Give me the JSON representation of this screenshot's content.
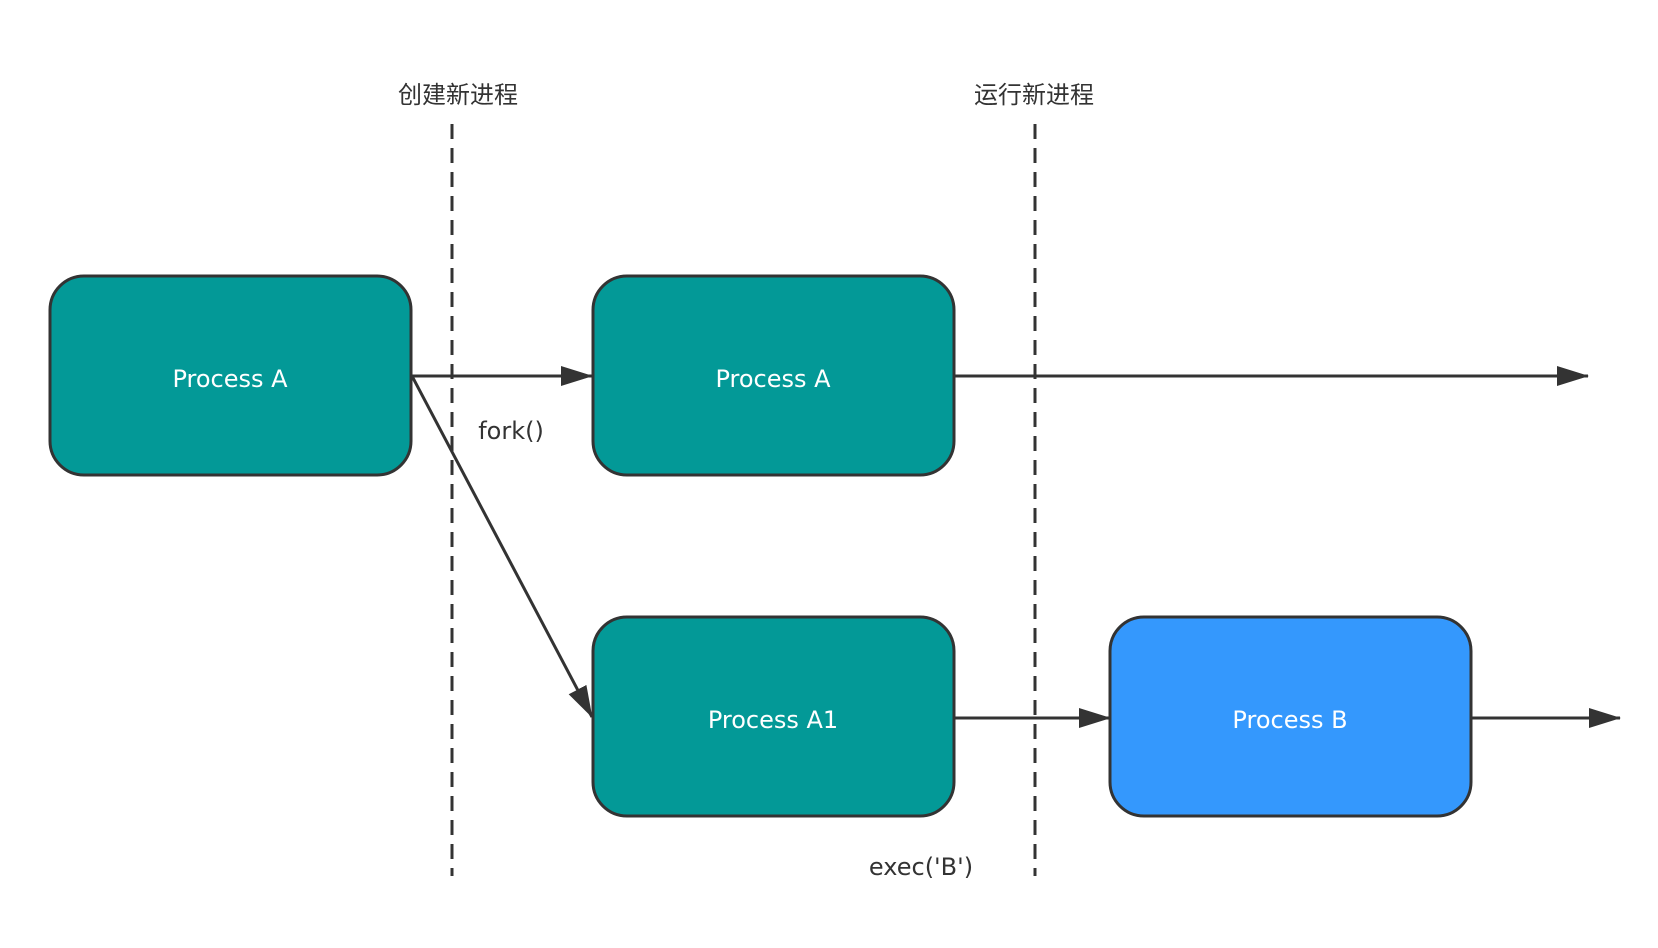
{
  "phase_labels": {
    "create": "创建新进程",
    "run": "运行新进程"
  },
  "edge_labels": {
    "fork": "fork()",
    "exec": "exec('B')"
  },
  "nodes": {
    "process_a_origin": "Process A",
    "process_a_parent": "Process A",
    "process_a1": "Process A1",
    "process_b": "Process B"
  },
  "colors": {
    "teal": "#039997",
    "blue": "#3498fd",
    "stroke": "#333333",
    "line": "#333333"
  }
}
